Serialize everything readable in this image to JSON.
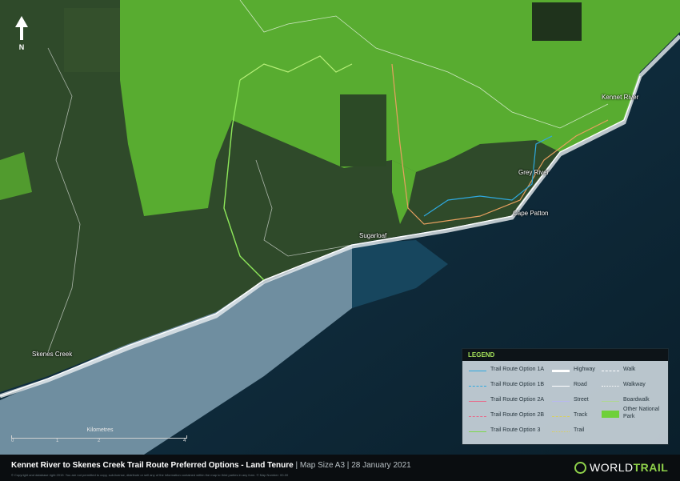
{
  "map": {
    "title": "Kennet River to Skenes Creek Trail Route Preferred Options - Land Tenure",
    "map_size": "Map Size A3",
    "date": "28 January 2021",
    "north_label": "N",
    "copyright": "© Copyright and database right 2019. You are not permitted to copy, sub-license, distribute or sell any of the information contained within the map to third parties in any form. © Map Number: 00-00",
    "logo": {
      "word1": "WORLD",
      "word2": "TRAIL"
    },
    "places": [
      {
        "name": "Kennet River"
      },
      {
        "name": "Grey River"
      },
      {
        "name": "Cape Patton"
      },
      {
        "name": "Sugarloaf"
      },
      {
        "name": "Skenes Creek"
      }
    ],
    "scale_bar": {
      "title": "Kilometres",
      "ticks": [
        "0",
        "1",
        "2",
        "4"
      ]
    },
    "legend": {
      "heading": "LEGEND",
      "items": [
        {
          "label": "Trail Route Option 1A",
          "color": "#2fa9e0",
          "style": "solid"
        },
        {
          "label": "Trail Route Option 1B",
          "color": "#2fa9e0",
          "style": "dashed"
        },
        {
          "label": "Trail Route Option 2A",
          "color": "#e86a8a",
          "style": "solid"
        },
        {
          "label": "Trail Route Option 2B",
          "color": "#e86a8a",
          "style": "dashed"
        },
        {
          "label": "Trail Route Option 3",
          "color": "#7cd94a",
          "style": "solid"
        },
        {
          "label": "Highway",
          "color": "#ffffff",
          "style": "thick"
        },
        {
          "label": "Road",
          "color": "#ffffff",
          "style": "solid"
        },
        {
          "label": "Street",
          "color": "#b8b8f0",
          "style": "solid"
        },
        {
          "label": "Track",
          "color": "#d8d060",
          "style": "dashed"
        },
        {
          "label": "Trail",
          "color": "#d8d060",
          "style": "dotted"
        },
        {
          "label": "Walk",
          "color": "#ffffff",
          "style": "dashed"
        },
        {
          "label": "Walkway",
          "color": "#ffffff",
          "style": "dotted"
        },
        {
          "label": "Boardwalk",
          "color": "#b0d890",
          "style": "solid"
        },
        {
          "label": "Other National Park",
          "color": "#6fd03a",
          "style": "fill"
        }
      ]
    }
  }
}
